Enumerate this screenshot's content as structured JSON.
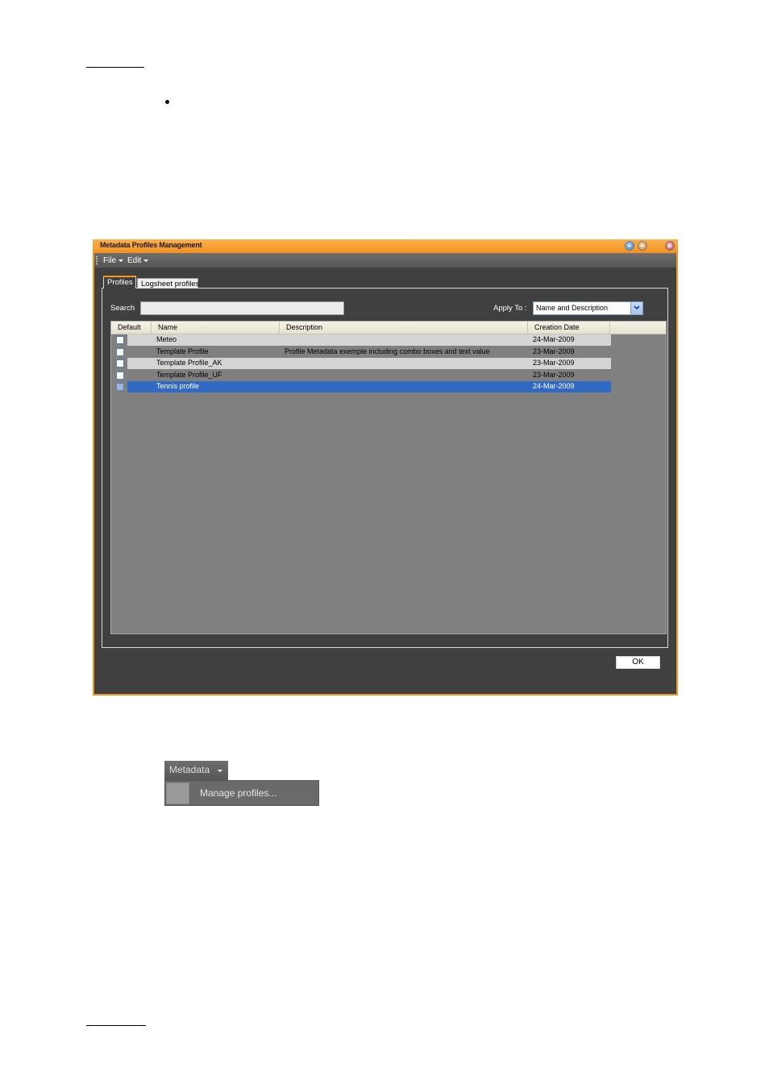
{
  "window": {
    "title": "Metadata Profiles Management",
    "menu": [
      {
        "label": "File"
      },
      {
        "label": "Edit"
      }
    ]
  },
  "tabs": [
    {
      "label": "Profiles",
      "active": true
    },
    {
      "label": "Logsheet profiles",
      "active": false
    }
  ],
  "search": {
    "label": "Search",
    "value": ""
  },
  "apply_to": {
    "label": "Apply To :",
    "selected": "Name and Description"
  },
  "grid": {
    "columns": [
      "Default",
      "Name",
      "Description",
      "Creation Date"
    ],
    "rows": [
      {
        "name": "Meteo",
        "description": "",
        "date": "24-Mar-2009",
        "default": false,
        "selected": false
      },
      {
        "name": "Template Profile",
        "description": "Profile Metadata exemple including combo boxes and text value",
        "date": "23-Mar-2009",
        "default": false,
        "selected": false
      },
      {
        "name": "Template Profile_AK",
        "description": "",
        "date": "23-Mar-2009",
        "default": false,
        "selected": false
      },
      {
        "name": "Template Profile_UF",
        "description": "",
        "date": "23-Mar-2009",
        "default": false,
        "selected": false
      },
      {
        "name": "Tennis profile",
        "description": "",
        "date": "24-Mar-2009",
        "default": false,
        "selected": true
      }
    ]
  },
  "ok_button": {
    "label": "OK"
  },
  "metadata_menu": {
    "button_label": "Metadata",
    "items": [
      {
        "label": "Manage profiles..."
      }
    ]
  },
  "colors": {
    "window_frame": "#f7941d",
    "selection": "#316ac5"
  }
}
